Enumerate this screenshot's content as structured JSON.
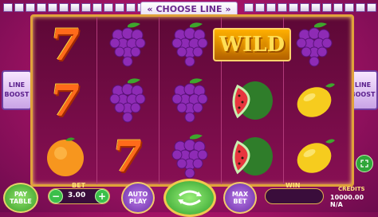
{
  "header": {
    "choose_line": "CHOOSE LINE",
    "arrow_left": "«",
    "arrow_right": "»"
  },
  "side": {
    "left": {
      "l1": "LINE",
      "l2": "BOOST"
    },
    "right": {
      "l1": "LINE",
      "l2": "BOOST"
    }
  },
  "reels": [
    [
      {
        "symbol": "seven",
        "text": "7"
      },
      {
        "symbol": "seven",
        "text": "7"
      },
      {
        "symbol": "orange-icon"
      }
    ],
    [
      {
        "symbol": "grapes-icon"
      },
      {
        "symbol": "grapes-icon"
      },
      {
        "symbol": "seven",
        "text": "7"
      }
    ],
    [
      {
        "symbol": "grapes-icon"
      },
      {
        "symbol": "grapes-icon"
      },
      {
        "symbol": "grapes-icon"
      }
    ],
    [
      {
        "symbol": "wild",
        "text": "WILD"
      },
      {
        "symbol": "watermelon-icon"
      },
      {
        "symbol": "watermelon-icon"
      }
    ],
    [
      {
        "symbol": "grapes-icon"
      },
      {
        "symbol": "lemon-icon"
      },
      {
        "symbol": "lemon-icon"
      }
    ]
  ],
  "controls": {
    "paytable_l1": "PAY",
    "paytable_l2": "TABLE",
    "bet_label": "BET",
    "bet_value": "3.00",
    "minus": "−",
    "plus": "+",
    "autoplay_l1": "AUTO",
    "autoplay_l2": "PLAY",
    "maxbet_l1": "MAX",
    "maxbet_l2": "BET",
    "win_label": "WIN",
    "credits_label": "CREDITS",
    "credits_value": "10000.00 N/A"
  },
  "colors": {
    "accent": "#e0a23a",
    "button_green": "#3bbf4a",
    "button_purple": "#7b3fb8"
  }
}
